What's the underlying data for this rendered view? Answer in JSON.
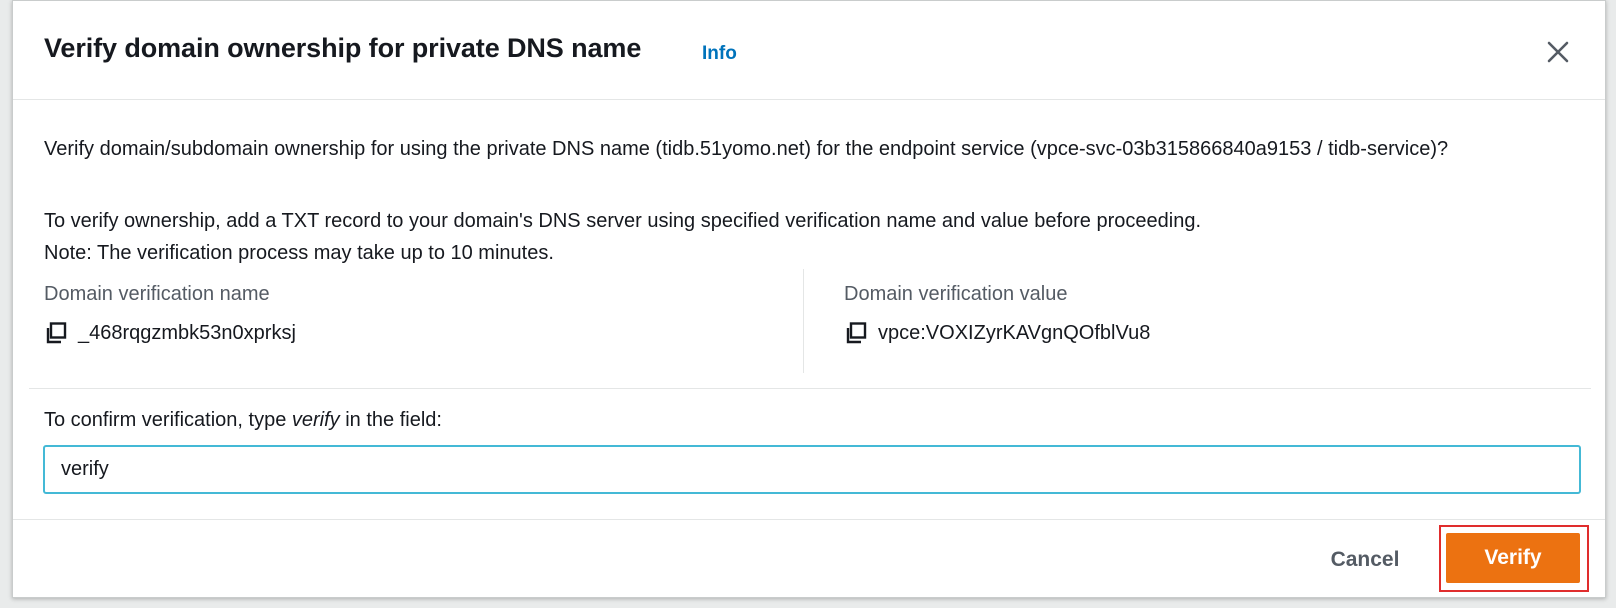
{
  "modal": {
    "title": "Verify domain ownership for private DNS name",
    "info_link": "Info",
    "close_icon": "close-icon"
  },
  "body": {
    "question": "Verify domain/subdomain ownership for using the private DNS name (tidb.51yomo.net) for the endpoint service (vpce-svc-03b315866840a9153 / tidb-service)?",
    "instruction": "To verify ownership, add a TXT record to your domain's DNS server using specified verification name and value before proceeding.",
    "note": "Note: The verification process may take up to 10 minutes."
  },
  "verification": {
    "name_label": "Domain verification name",
    "name_value": "_468rqgzmbk53n0xprksj",
    "value_label": "Domain verification value",
    "value_value": "vpce:VOXIZyrKAVgnQOfblVu8",
    "copy_icon": "copy-icon"
  },
  "confirm": {
    "label_prefix": "To confirm verification, type ",
    "label_keyword": "verify",
    "label_suffix": " in the field:",
    "input_value": "verify"
  },
  "footer": {
    "cancel_label": "Cancel",
    "verify_label": "Verify"
  },
  "colors": {
    "primary_button": "#ec7211",
    "link": "#0073bb",
    "input_focus": "#44b9d6",
    "highlight": "#e02d2d"
  }
}
